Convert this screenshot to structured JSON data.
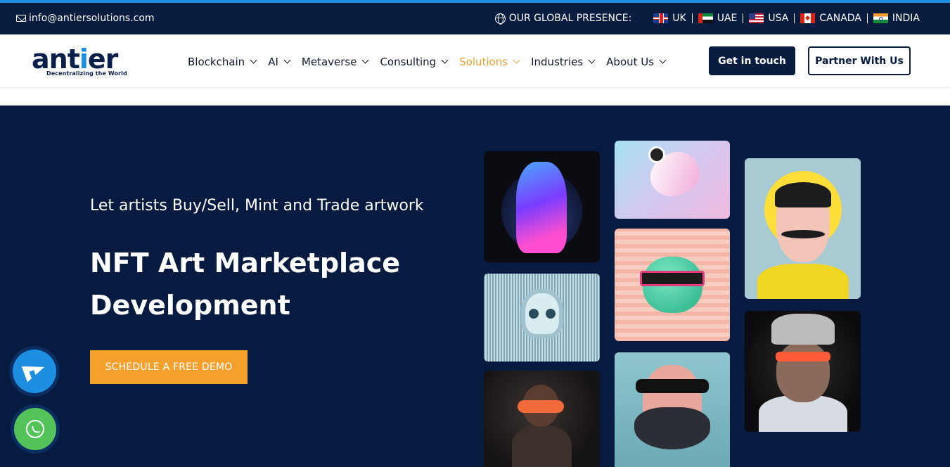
{
  "topbar": {
    "email": "info@antiersolutions.com",
    "presence_label": "OUR GLOBAL PRESENCE:",
    "countries": [
      {
        "name": "UK",
        "flag": "uk-flag-icon"
      },
      {
        "name": "UAE",
        "flag": "uae-flag-icon"
      },
      {
        "name": "USA",
        "flag": "usa-flag-icon"
      },
      {
        "name": "CANADA",
        "flag": "canada-flag-icon"
      },
      {
        "name": "INDIA",
        "flag": "india-flag-icon"
      }
    ]
  },
  "header": {
    "logo_text": "antier",
    "logo_tagline": "Decentralizing the World",
    "nav": [
      {
        "label": "Blockchain"
      },
      {
        "label": "AI"
      },
      {
        "label": "Metaverse"
      },
      {
        "label": "Consulting"
      },
      {
        "label": "Solutions",
        "active": true
      },
      {
        "label": "Industries"
      },
      {
        "label": "About Us"
      }
    ],
    "cta_primary": "Get in touch",
    "cta_secondary": "Partner With Us"
  },
  "hero": {
    "kicker": "Let artists Buy/Sell, Mint and Trade artwork",
    "headline_line1": "NFT Art Marketplace",
    "headline_line2": "Development",
    "cta": "SCHEDULE A FREE DEMO"
  },
  "colors": {
    "navy": "#061b3f",
    "accent_blue": "#1d8fe1",
    "accent_orange": "#f5a02d",
    "nav_active": "#f0a030",
    "telegram": "#1e8ee0",
    "whatsapp": "#54c35a"
  }
}
